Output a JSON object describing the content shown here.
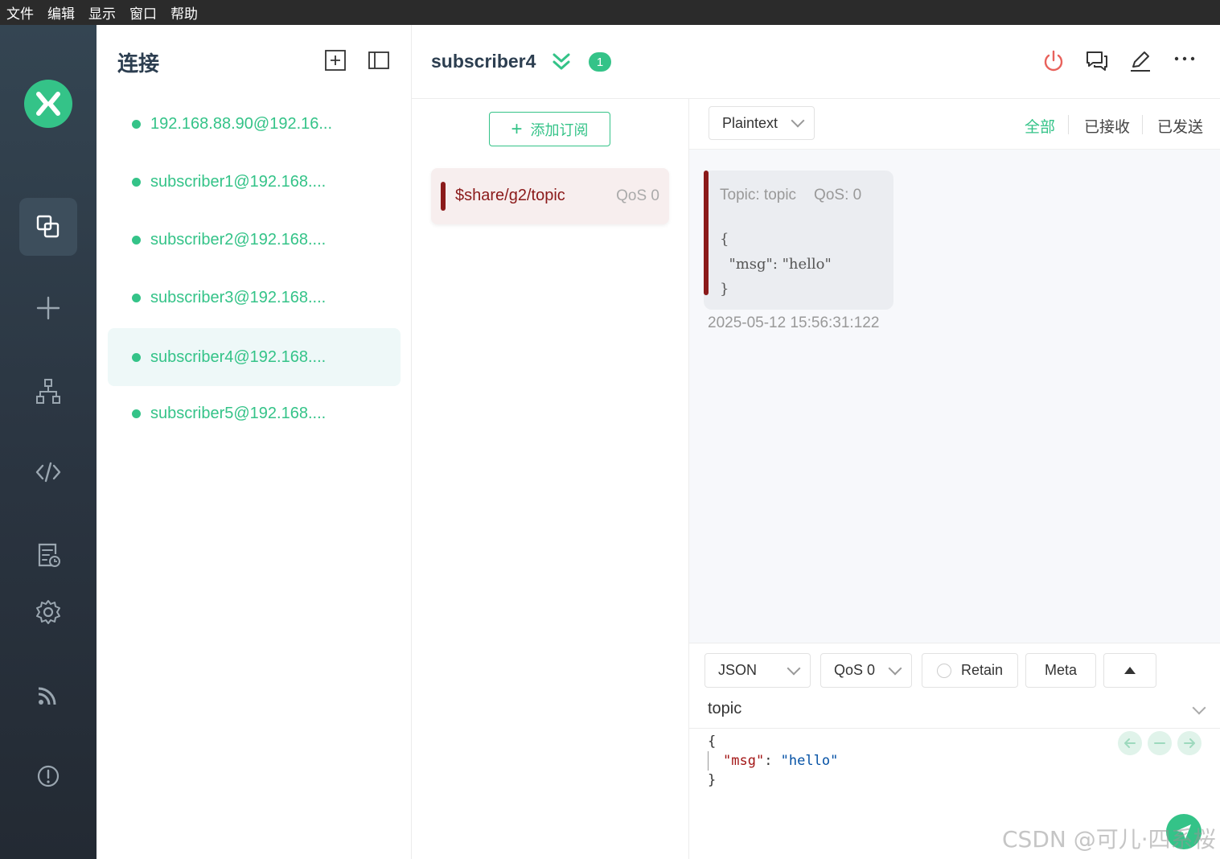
{
  "menubar": {
    "items": [
      "文件",
      "编辑",
      "显示",
      "窗口",
      "帮助"
    ]
  },
  "sidebar": {
    "icons": [
      "logo-icon",
      "connections-icon",
      "new-connection-icon",
      "topology-icon",
      "script-icon",
      "log-icon",
      "settings-icon",
      "feed-icon",
      "about-icon"
    ],
    "active": "connections-icon"
  },
  "connections": {
    "title": "连接",
    "items": [
      {
        "label": "192.168.88.90@192.16..."
      },
      {
        "label": "subscriber1@192.168...."
      },
      {
        "label": "subscriber2@192.168...."
      },
      {
        "label": "subscriber3@192.168...."
      },
      {
        "label": "subscriber4@192.168....",
        "active": true
      },
      {
        "label": "subscriber5@192.168...."
      }
    ]
  },
  "header": {
    "title": "subscriber4",
    "badge": "1"
  },
  "subscriptions": {
    "add_label": "添加订阅",
    "items": [
      {
        "topic": "$share/g2/topic",
        "qos": "QoS 0",
        "color": "#8b1a1a"
      }
    ]
  },
  "messages": {
    "format": "Plaintext",
    "filters": [
      "全部",
      "已接收",
      "已发送"
    ],
    "active_filter": "全部",
    "items": [
      {
        "topic": "Topic: topic",
        "qos": "QoS: 0",
        "payload": "{\n  \"msg\": \"hello\"\n}",
        "time": "2025-05-12 15:56:31:122"
      }
    ]
  },
  "publish": {
    "format": "JSON",
    "qos": "QoS 0",
    "retain_label": "Retain",
    "meta_label": "Meta",
    "topic": "topic",
    "payload": {
      "open": "{",
      "key": "\"msg\"",
      "colon": ": ",
      "value": "\"hello\"",
      "close": "}"
    }
  },
  "watermark": "CSDN @可儿·四系桜",
  "colors": {
    "accent": "#34c388",
    "topic": "#8b1a1a",
    "rail": "#2a3440"
  }
}
